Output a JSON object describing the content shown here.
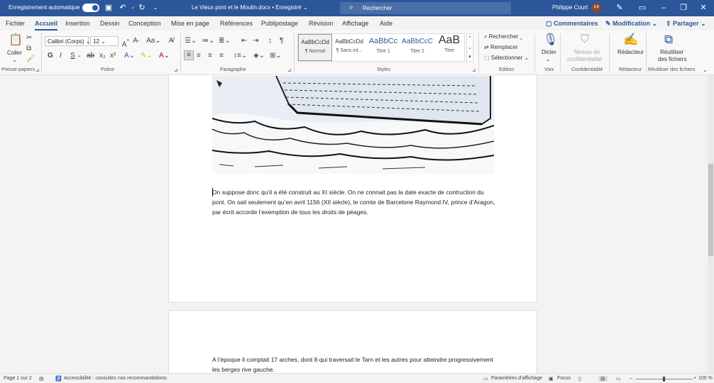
{
  "titlebar": {
    "autosave_label": "Enregistrement automatique",
    "doc_title": "Le Vieux pont et le Moulin.docx • Enregistré ⌄",
    "search_placeholder": "Rechercher",
    "user_name": "Philippe Court",
    "user_initials": "PP"
  },
  "tabs": [
    "Fichier",
    "Accueil",
    "Insertion",
    "Dessin",
    "Conception",
    "Mise en page",
    "Références",
    "Publipostage",
    "Révision",
    "Affichage",
    "Aide"
  ],
  "tab_actions": {
    "comments": "Commentaires",
    "editing": "Modification",
    "share": "Partager"
  },
  "ribbon": {
    "clipboard": {
      "paste": "Coller",
      "group": "Presse-papiers"
    },
    "font": {
      "font_name": "Calibri (Corps)",
      "font_size": "12",
      "group": "Police"
    },
    "paragraph": {
      "group": "Paragraphe"
    },
    "styles": {
      "items": [
        {
          "preview": "AaBbCcDd",
          "name": "¶ Normal"
        },
        {
          "preview": "AaBbCcDd",
          "name": "¶ Sans int..."
        },
        {
          "preview": "AaBbCc",
          "name": "Titre 1"
        },
        {
          "preview": "AaBbCcC",
          "name": "Titre 2"
        },
        {
          "preview": "AaB",
          "name": "Titre"
        }
      ],
      "group": "Styles"
    },
    "editing": {
      "find": "Rechercher",
      "replace": "Remplacer",
      "select": "Sélectionner",
      "group": "Edition"
    },
    "voice": {
      "dictate": "Dicter",
      "group": "Voix"
    },
    "sensitivity": {
      "label1": "Niveau de",
      "label2": "confidentialité",
      "group": "Confidentialité"
    },
    "editor": {
      "label": "Rédacteur",
      "group": "Rédacteur"
    },
    "reuse": {
      "label1": "Réutiliser",
      "label2": "des fichiers",
      "group": "Réutiliser des fichiers"
    }
  },
  "document": {
    "paragraph1": "On suppose donc qu’il a été construit au XI siècle. On ne connait pas la date exacte de contruction du pont. On sait seulement qu’en avril 1156 (XII siècle), le comte de Barcelone Raymond IV, prince d’Aragon, par écrit accorde l’exemption de tous les droits de péages.",
    "paragraph2": "A l’époque il comptait 17 arches, dont 8 qui traversait le Tarn et les autres pour atteindre progressivement les berges rive gauche."
  },
  "status": {
    "page": "Page 1 sur 2",
    "accessibility": "Accessibilité : consultez nos recommandations",
    "display_settings": "Paramètres d’affichage",
    "focus": "Focus",
    "zoom": "100 %"
  },
  "colors": {
    "accent": "#2b579a"
  }
}
